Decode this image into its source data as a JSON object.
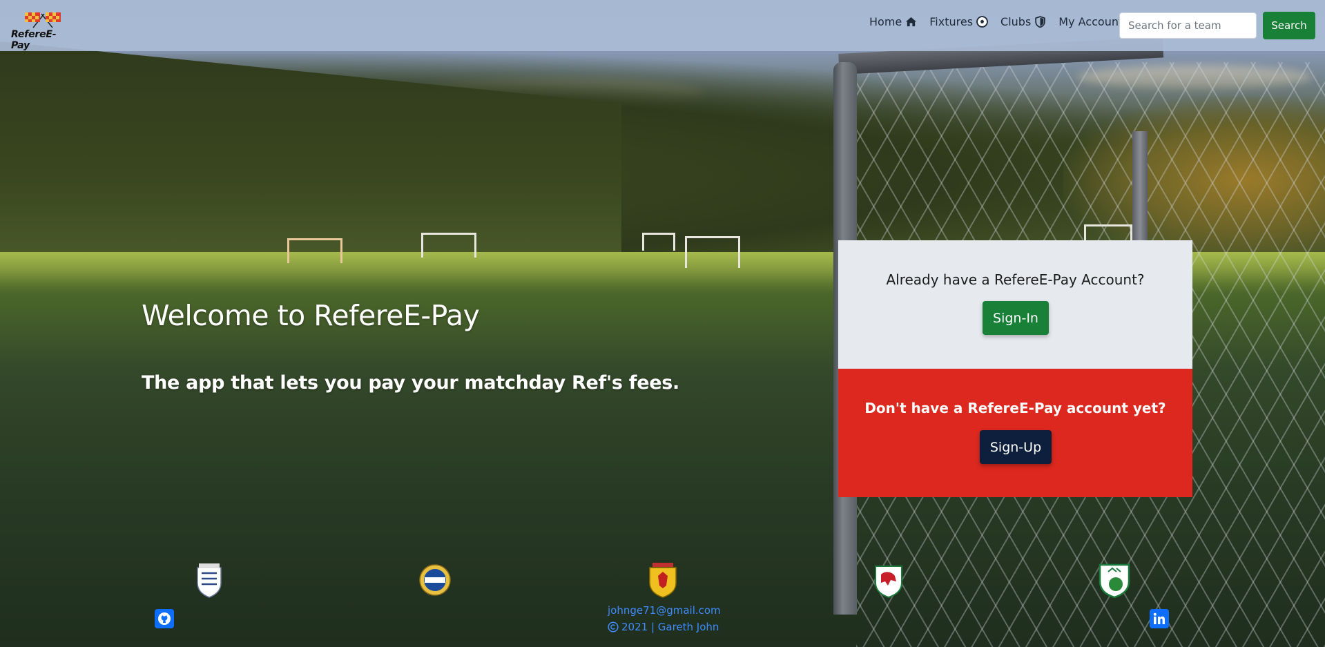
{
  "brand": {
    "name": "RefereE-Pay"
  },
  "nav": {
    "home": "Home",
    "fixtures": "Fixtures",
    "clubs": "Clubs",
    "account": "My Account"
  },
  "search": {
    "placeholder": "Search for a team",
    "button": "Search"
  },
  "hero": {
    "title": "Welcome to RefereE-Pay",
    "subtitle": "The app that lets you pay your matchday Ref's fees."
  },
  "signin_panel": {
    "question": "Already have a RefereE-Pay Account?",
    "button": "Sign-In"
  },
  "signup_panel": {
    "question": "Don't have a RefereE-Pay account yet?",
    "button": "Sign-Up"
  },
  "crests": [
    "england-fa-crest",
    "northern-ireland-ifa-crest",
    "scotland-sfa-crest",
    "wales-faw-crest",
    "ireland-fai-crest"
  ],
  "footer": {
    "email": "johnge71@gmail.com",
    "copyright": "2021 | Gareth John"
  },
  "colors": {
    "primary_green": "#198038",
    "panel_red": "#dc281e",
    "panel_grey": "#e6e9ed",
    "navy": "#0d1f3c",
    "link_blue": "#3d8bfd"
  }
}
